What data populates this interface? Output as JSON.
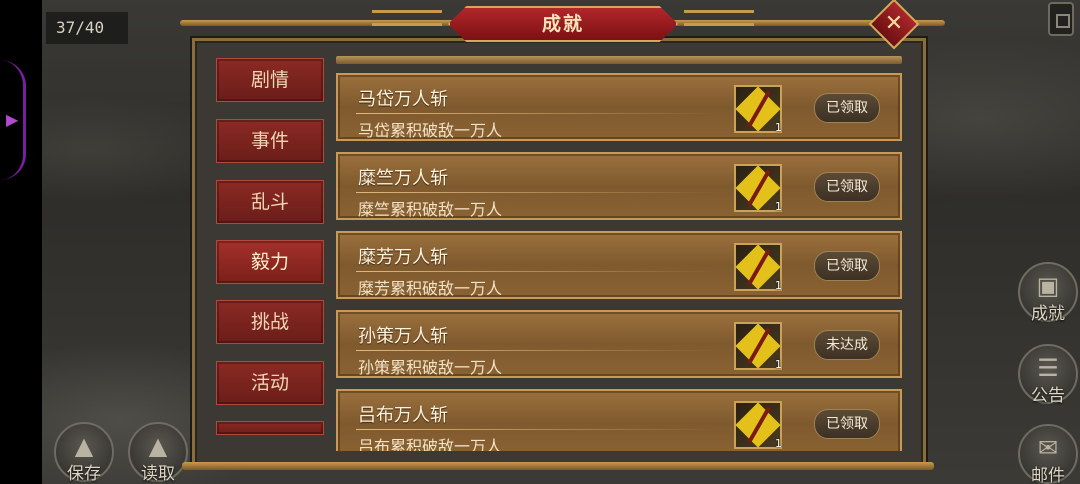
{
  "hud": {
    "counter": "37/40"
  },
  "window": {
    "title": "成就",
    "close_icon": "close-icon"
  },
  "tabs": [
    {
      "label": "剧情"
    },
    {
      "label": "事件"
    },
    {
      "label": "乱斗"
    },
    {
      "label": "毅力"
    },
    {
      "label": "挑战"
    },
    {
      "label": "活动"
    },
    {
      "label": ""
    }
  ],
  "achievements": [
    {
      "name": "马岱万人斩",
      "desc": "马岱累积破敌一万人",
      "reward_icon": "zhan-badge-icon",
      "reward_count": "1",
      "status": "已领取"
    },
    {
      "name": "糜竺万人斩",
      "desc": "糜竺累积破敌一万人",
      "reward_icon": "zhan-badge-icon",
      "reward_count": "1",
      "status": "已领取"
    },
    {
      "name": "糜芳万人斩",
      "desc": "糜芳累积破敌一万人",
      "reward_icon": "zhan-badge-icon",
      "reward_count": "1",
      "status": "已领取"
    },
    {
      "name": "孙策万人斩",
      "desc": "孙策累积破敌一万人",
      "reward_icon": "zhan-badge-icon",
      "reward_count": "1",
      "status": "未达成"
    },
    {
      "name": "吕布万人斩",
      "desc": "吕布累积破敌一万人",
      "reward_icon": "zhan-badge-icon",
      "reward_count": "1",
      "status": "已领取"
    }
  ],
  "left_buttons": {
    "save": "保存",
    "load": "读取"
  },
  "right_buttons": {
    "achievement": "成就",
    "notice": "公告",
    "mail": "邮件"
  },
  "colors": {
    "tab_red": "#8b2a24",
    "title_red": "#b2262a",
    "card_brown": "#9b703d",
    "gold_trim": "#c99a4c"
  }
}
